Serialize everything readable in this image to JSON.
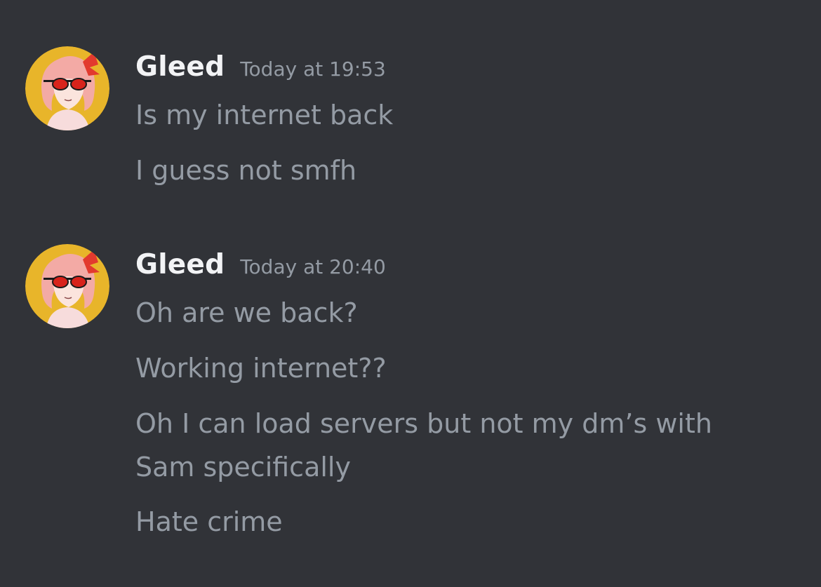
{
  "messages": [
    {
      "username": "Gleed",
      "timestamp": "Today at 19:53",
      "avatar_icon": "anime-girl-sunglasses-avatar",
      "lines": [
        "Is my internet back",
        "I guess not smfh"
      ]
    },
    {
      "username": "Gleed",
      "timestamp": "Today at 20:40",
      "avatar_icon": "anime-girl-sunglasses-avatar",
      "lines": [
        "Oh are we back?",
        "Working internet??",
        "Oh I can load servers but not my dm’s with",
        "Sam specifically",
        "Hate crime"
      ]
    }
  ],
  "colors": {
    "background": "#313338",
    "username": "#f2f3f5",
    "timestamp": "#949ba4",
    "message_text": "#949ba4",
    "avatar_bg": "#e8b52a"
  }
}
